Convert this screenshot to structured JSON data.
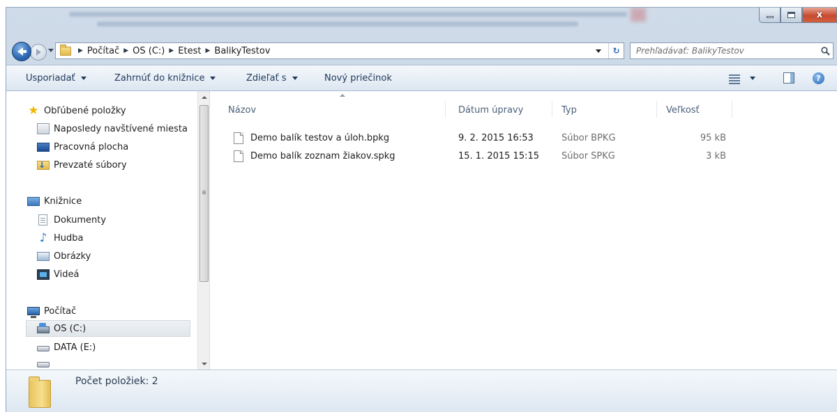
{
  "window": {
    "caption_buttons": {
      "minimize": "–",
      "maximize": "□",
      "close": "x"
    }
  },
  "address": {
    "crumbs": [
      "Počítač",
      "OS (C:)",
      "Etest",
      "BalikyTestov"
    ]
  },
  "search": {
    "placeholder": "Prehľadávať: BalikyTestov"
  },
  "toolbar": {
    "organize": "Usporiadať",
    "include_in_library": "Zahrnúť do knižnice",
    "share": "Zdieľať s",
    "new_folder": "Nový priečinok"
  },
  "nav": {
    "favorites": "Obľúbené položky",
    "recent": "Naposledy navštívené miesta",
    "desktop": "Pracovná plocha",
    "downloads": "Prevzaté súbory",
    "libraries": "Knižnice",
    "documents": "Dokumenty",
    "music": "Hudba",
    "pictures": "Obrázky",
    "videos": "Videá",
    "computer": "Počítač",
    "drive_c": "OS (C:)",
    "drive_e": "DATA (E:)"
  },
  "columns": {
    "name": "Názov",
    "modified": "Dátum úpravy",
    "type": "Typ",
    "size": "Veľkosť"
  },
  "files": [
    {
      "name": "Demo balík testov a úloh.bpkg",
      "modified": "9. 2. 2015 16:53",
      "type": "Súbor BPKG",
      "size": "95 kB"
    },
    {
      "name": "Demo balík zoznam žiakov.spkg",
      "modified": "15. 1. 2015 15:15",
      "type": "Súbor SPKG",
      "size": "3 kB"
    }
  ],
  "status": {
    "item_count": "Počet položiek: 2"
  },
  "icons": {
    "back": "back-arrow-icon",
    "forward": "forward-arrow-icon",
    "refresh": "refresh-icon",
    "search": "search-icon",
    "views": "views-icon",
    "preview_pane": "preview-pane-icon",
    "help": "help-icon"
  },
  "colors": {
    "accent": "#1e395b",
    "window_frame": "#c1d2e4",
    "close_button": "#c74a31"
  }
}
